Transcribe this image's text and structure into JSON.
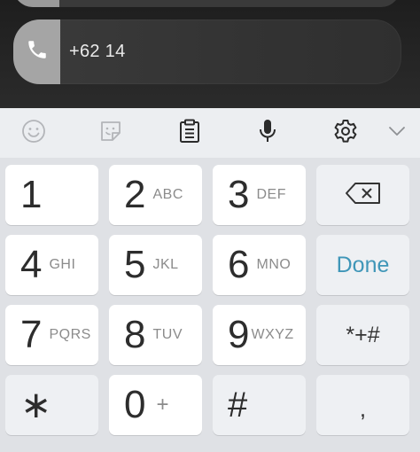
{
  "phone_field": {
    "prefix": "+62",
    "number": " 14"
  },
  "toolbar": {
    "items": [
      "emoji-icon",
      "sticker-icon",
      "clipboard-icon",
      "microphone-icon",
      "settings-icon",
      "chevron-down-icon"
    ]
  },
  "keypad": {
    "k1": {
      "num": "1",
      "sub": ""
    },
    "k2": {
      "num": "2",
      "sub": "ABC"
    },
    "k3": {
      "num": "3",
      "sub": "DEF"
    },
    "k4": {
      "num": "4",
      "sub": "GHI"
    },
    "k5": {
      "num": "5",
      "sub": "JKL"
    },
    "k6": {
      "num": "6",
      "sub": "MNO"
    },
    "k7": {
      "num": "7",
      "sub": "PQRS"
    },
    "k8": {
      "num": "8",
      "sub": "TUV"
    },
    "k9": {
      "num": "9",
      "sub": "WXYZ"
    },
    "kstar": {
      "num": "∗"
    },
    "k0": {
      "num": "0",
      "sub": "+"
    },
    "khash": {
      "num": "#"
    },
    "done": "Done",
    "symbols": "*+#",
    "comma": ","
  },
  "colors": {
    "done_accent": "#3f96b8"
  }
}
